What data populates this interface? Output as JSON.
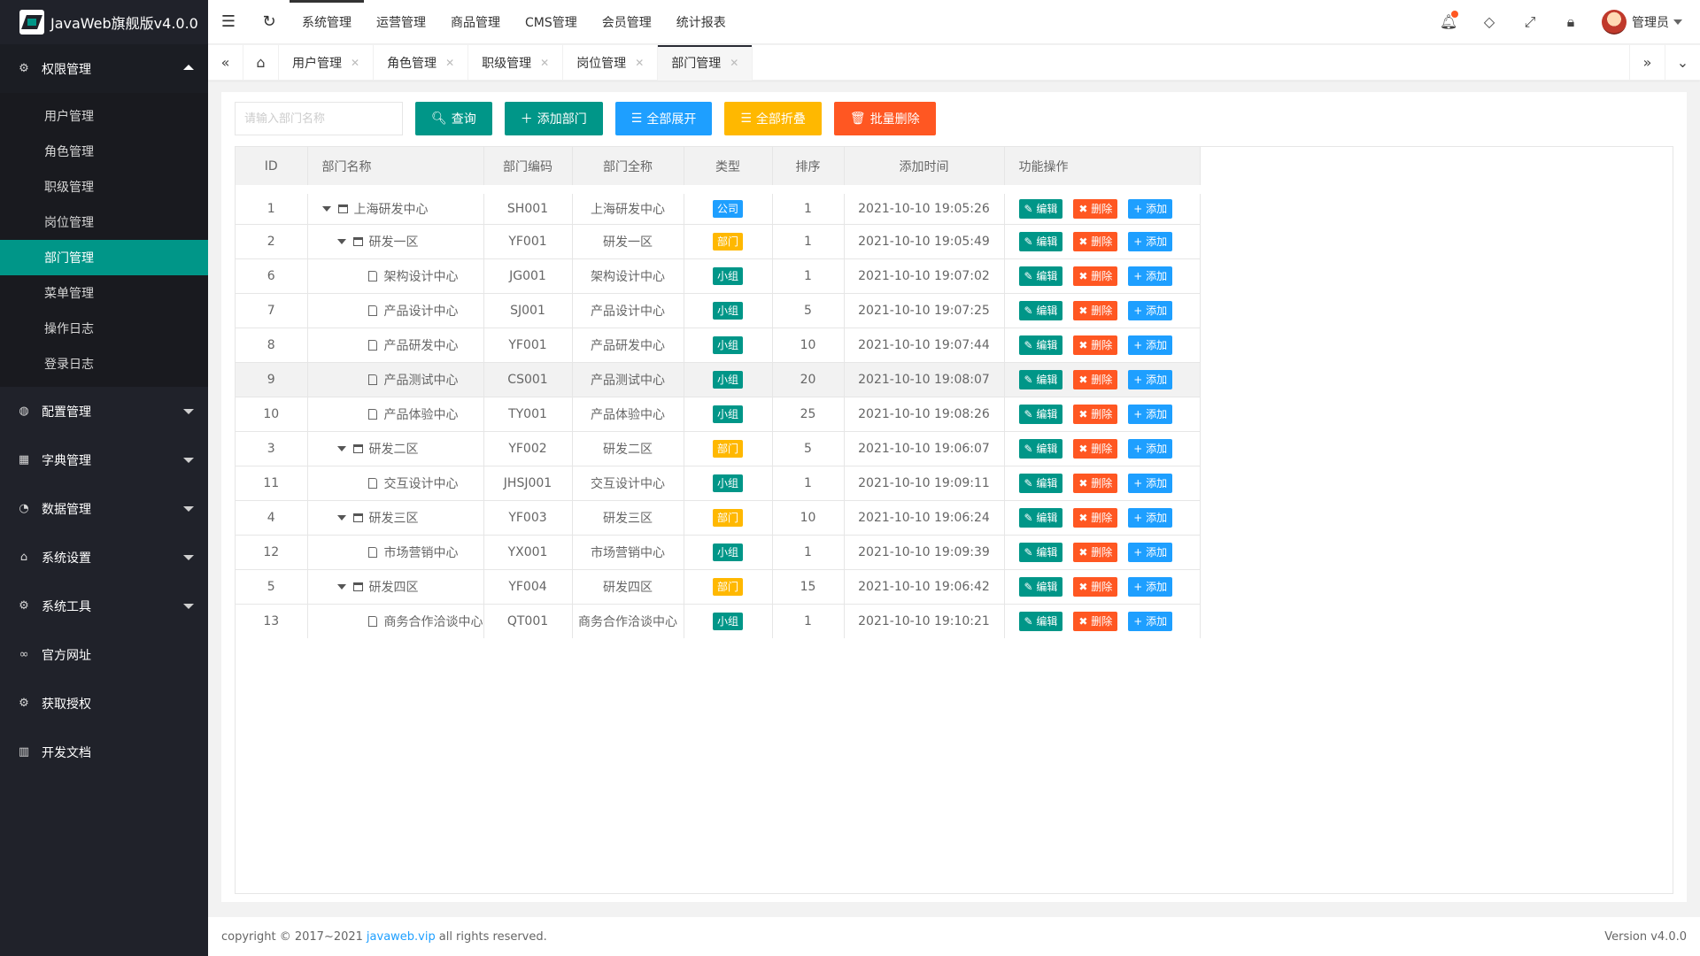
{
  "app": {
    "title": "JavaWeb旗舰版v4.0.0"
  },
  "sidebar": {
    "groups": [
      {
        "label": "权限管理",
        "icon": "gear-icon",
        "open": true,
        "items": [
          "用户管理",
          "角色管理",
          "职级管理",
          "岗位管理",
          "部门管理",
          "菜单管理",
          "操作日志",
          "登录日志"
        ]
      },
      {
        "label": "配置管理",
        "icon": "globe-icon"
      },
      {
        "label": "字典管理",
        "icon": "grid-icon"
      },
      {
        "label": "数据管理",
        "icon": "dashboard-icon"
      },
      {
        "label": "系统设置",
        "icon": "home-icon"
      },
      {
        "label": "系统工具",
        "icon": "gear-icon"
      },
      {
        "label": "官方网址",
        "icon": "link-icon"
      },
      {
        "label": "获取授权",
        "icon": "gear-icon"
      },
      {
        "label": "开发文档",
        "icon": "book-icon"
      }
    ],
    "active_item": "部门管理"
  },
  "header": {
    "nav": [
      "系统管理",
      "运营管理",
      "商品管理",
      "CMS管理",
      "会员管理",
      "统计报表"
    ],
    "user": "管理员"
  },
  "tabs": [
    "用户管理",
    "角色管理",
    "职级管理",
    "岗位管理",
    "部门管理"
  ],
  "toolbar": {
    "search_placeholder": "请输入部门名称",
    "query": "查询",
    "add": "添加部门",
    "expand": "全部展开",
    "collapse": "全部折叠",
    "batch_delete": "批量删除"
  },
  "table": {
    "headers": [
      "ID",
      "部门名称",
      "部门编码",
      "部门全称",
      "类型",
      "排序",
      "添加时间",
      "功能操作"
    ],
    "op_labels": {
      "edit": "编辑",
      "delete": "删除",
      "add": "添加"
    },
    "rows": [
      {
        "id": "1",
        "name": "上海研发中心",
        "level": 0,
        "kind": "folder",
        "code": "SH001",
        "fullname": "上海研发中心",
        "type": "公司",
        "sort": "1",
        "time": "2021-10-10 19:05:26"
      },
      {
        "id": "2",
        "name": "研发一区",
        "level": 1,
        "kind": "folder",
        "code": "YF001",
        "fullname": "研发一区",
        "type": "部门",
        "sort": "1",
        "time": "2021-10-10 19:05:49"
      },
      {
        "id": "6",
        "name": "架构设计中心",
        "level": 2,
        "kind": "doc",
        "code": "JG001",
        "fullname": "架构设计中心",
        "type": "小组",
        "sort": "1",
        "time": "2021-10-10 19:07:02"
      },
      {
        "id": "7",
        "name": "产品设计中心",
        "level": 2,
        "kind": "doc",
        "code": "SJ001",
        "fullname": "产品设计中心",
        "type": "小组",
        "sort": "5",
        "time": "2021-10-10 19:07:25"
      },
      {
        "id": "8",
        "name": "产品研发中心",
        "level": 2,
        "kind": "doc",
        "code": "YF001",
        "fullname": "产品研发中心",
        "type": "小组",
        "sort": "10",
        "time": "2021-10-10 19:07:44"
      },
      {
        "id": "9",
        "name": "产品测试中心",
        "level": 2,
        "kind": "doc",
        "code": "CS001",
        "fullname": "产品测试中心",
        "type": "小组",
        "sort": "20",
        "time": "2021-10-10 19:08:07"
      },
      {
        "id": "10",
        "name": "产品体验中心",
        "level": 2,
        "kind": "doc",
        "code": "TY001",
        "fullname": "产品体验中心",
        "type": "小组",
        "sort": "25",
        "time": "2021-10-10 19:08:26"
      },
      {
        "id": "3",
        "name": "研发二区",
        "level": 1,
        "kind": "folder",
        "code": "YF002",
        "fullname": "研发二区",
        "type": "部门",
        "sort": "5",
        "time": "2021-10-10 19:06:07"
      },
      {
        "id": "11",
        "name": "交互设计中心",
        "level": 2,
        "kind": "doc",
        "code": "JHSJ001",
        "fullname": "交互设计中心",
        "type": "小组",
        "sort": "1",
        "time": "2021-10-10 19:09:11"
      },
      {
        "id": "4",
        "name": "研发三区",
        "level": 1,
        "kind": "folder",
        "code": "YF003",
        "fullname": "研发三区",
        "type": "部门",
        "sort": "10",
        "time": "2021-10-10 19:06:24"
      },
      {
        "id": "12",
        "name": "市场营销中心",
        "level": 2,
        "kind": "doc",
        "code": "YX001",
        "fullname": "市场营销中心",
        "type": "小组",
        "sort": "1",
        "time": "2021-10-10 19:09:39"
      },
      {
        "id": "5",
        "name": "研发四区",
        "level": 1,
        "kind": "folder",
        "code": "YF004",
        "fullname": "研发四区",
        "type": "部门",
        "sort": "15",
        "time": "2021-10-10 19:06:42"
      },
      {
        "id": "13",
        "name": "商务合作洽谈中心",
        "level": 2,
        "kind": "doc",
        "code": "QT001",
        "fullname": "商务合作洽谈中心",
        "type": "小组",
        "sort": "1",
        "time": "2021-10-10 19:10:21"
      }
    ],
    "highlighted_id": "9"
  },
  "footer": {
    "prefix": "copyright © 2017~2021",
    "link": "javaweb.vip",
    "suffix": "all rights reserved.",
    "version": "Version v4.0.0"
  },
  "colors": {
    "primary": "#009688",
    "blue": "#1e9fff",
    "orange": "#ffb800",
    "red": "#ff5722",
    "sidebar": "#20222a"
  }
}
